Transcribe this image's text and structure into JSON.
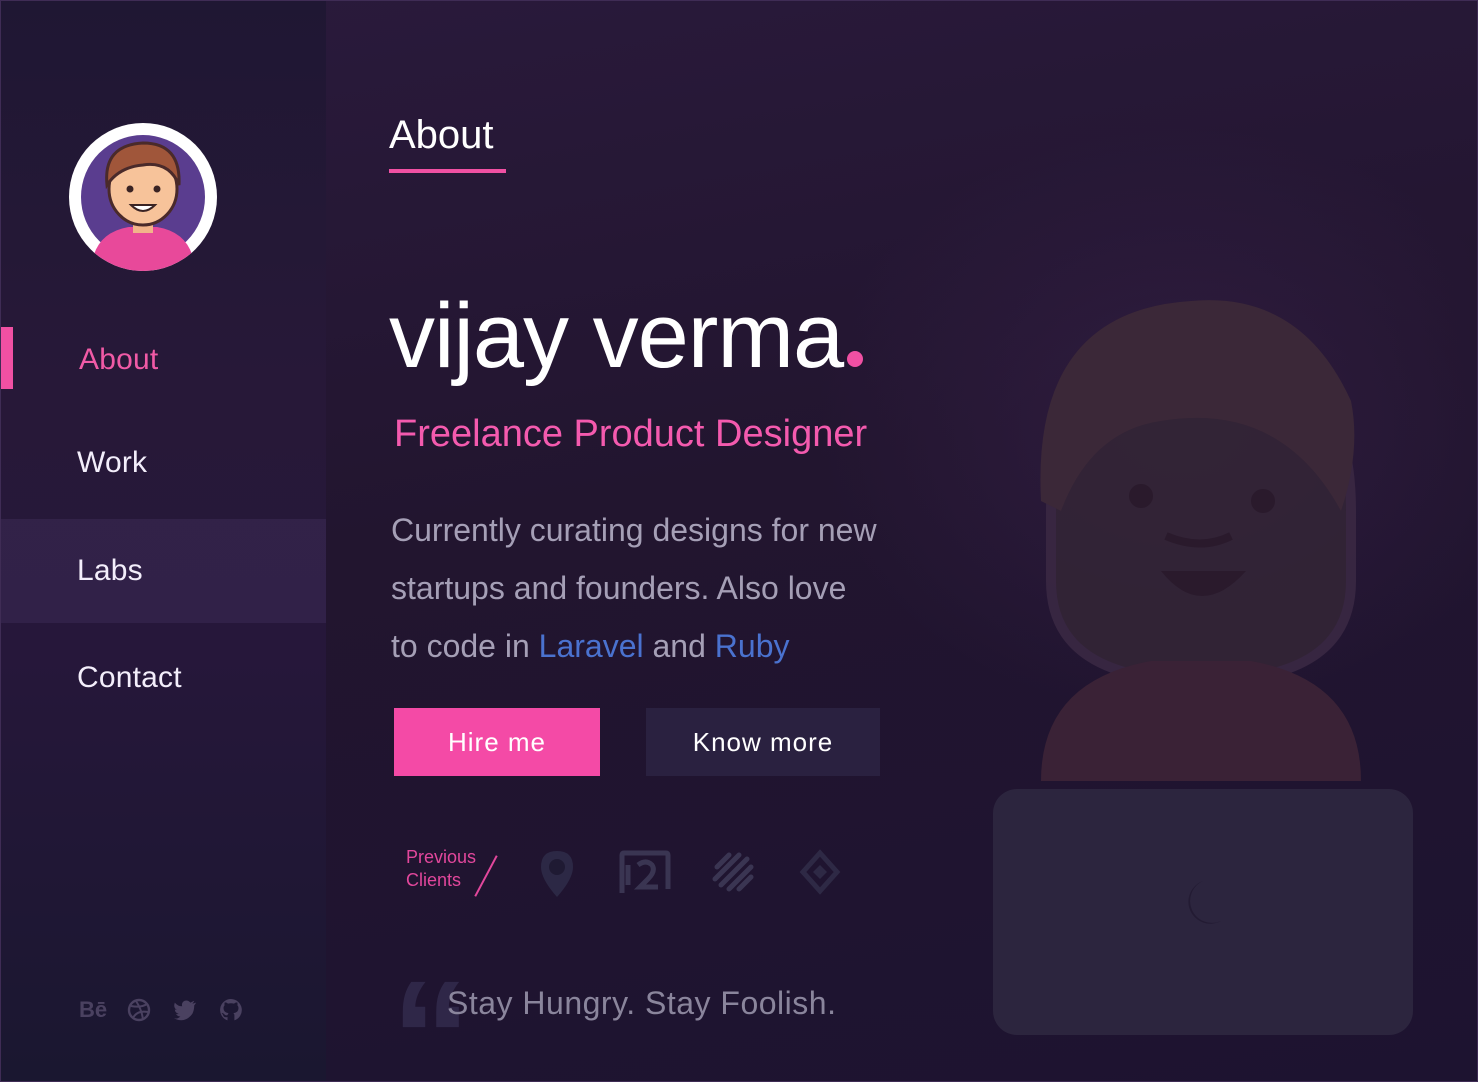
{
  "sidebar": {
    "nav": [
      {
        "label": "About",
        "active": true
      },
      {
        "label": "Work",
        "active": false
      },
      {
        "label": "Labs",
        "active": false
      },
      {
        "label": "Contact",
        "active": false
      }
    ],
    "social_icons": [
      "behance-icon",
      "dribbble-icon",
      "twitter-icon",
      "github-icon"
    ],
    "behance_glyph": "Bē"
  },
  "main": {
    "page_tab": "About",
    "name_first": "vijay",
    "name_last": "verma",
    "role": "Freelance Product Designer",
    "bio": {
      "line1": "Currently curating designs for new",
      "line2": "startups and founders. Also love",
      "line3_prefix": "to code in ",
      "highlight1": "Laravel",
      "line3_mid": " and ",
      "highlight2": "Ruby"
    },
    "buttons": {
      "primary": "Hire me",
      "secondary": "Know more"
    },
    "clients": {
      "label_line1": "Previous",
      "label_line2": "Clients",
      "logos": [
        "location-pin-logo",
        "p2-logo",
        "stripes-logo",
        "diamond-logo"
      ]
    },
    "quote": "Stay Hungry. Stay Foolish."
  },
  "colors": {
    "accent": "#f050a3",
    "link": "#4a72cf",
    "background": "#22152f"
  }
}
